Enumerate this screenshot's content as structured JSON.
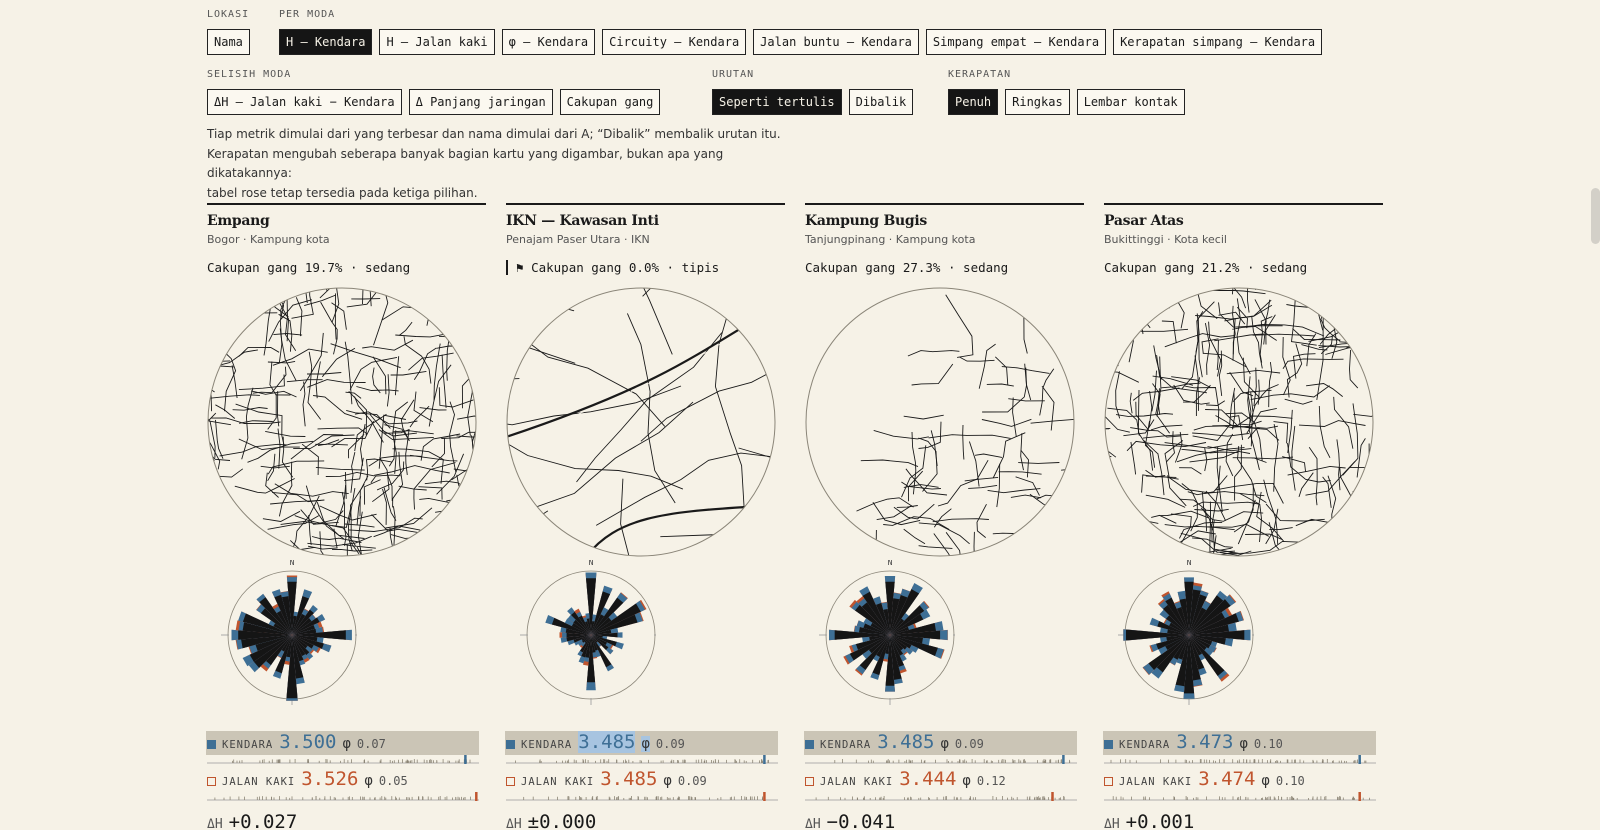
{
  "controls": {
    "lokasi": {
      "caption": "LOKASI",
      "options": [
        "Nama"
      ]
    },
    "per_moda": {
      "caption": "PER MODA",
      "options": [
        "H — Kendara",
        "H — Jalan kaki",
        "φ — Kendara",
        "Circuity — Kendara",
        "Jalan buntu — Kendara",
        "Simpang empat — Kendara",
        "Kerapatan simpang — Kendara"
      ],
      "active": "H — Kendara"
    },
    "selisih_moda": {
      "caption": "SELISIH MODA",
      "options": [
        "ΔH — Jalan kaki − Kendara",
        "Δ Panjang jaringan",
        "Cakupan gang"
      ]
    },
    "urutan": {
      "caption": "URUTAN",
      "options": [
        "Seperti tertulis",
        "Dibalik"
      ],
      "active": "Seperti tertulis"
    },
    "kerapatan": {
      "caption": "KERAPATAN",
      "options": [
        "Penuh",
        "Ringkas",
        "Lembar kontak"
      ],
      "active": "Penuh"
    }
  },
  "description": [
    "Tiap metrik dimulai dari yang terbesar dan nama dimulai dari A; “Dibalik” membalik urutan itu.",
    "Kerapatan mengubah seberapa banyak bagian kartu yang digambar, bukan apa yang dikatakannya:",
    "tabel rose tetap tersedia pada ketiga pilihan."
  ],
  "labels": {
    "north": "N",
    "kendara": "KENDARA",
    "jalan_kaki": "JALAN KAKI",
    "phi": "φ",
    "delta": "ΔH"
  },
  "colors": {
    "drive": "#3e6f95",
    "walk": "#c0552e",
    "ink": "#1a1a1a",
    "paper": "#f6f2e7",
    "highlight": "#a7c4e0"
  },
  "cards": [
    {
      "title": "Empang",
      "subtitle": "Bogor · Kampung kota",
      "coverage": "Cakupan gang 19.7% · sedang",
      "flag": false,
      "drive": {
        "h": "3.500",
        "phi": "0.07",
        "pos": 0.95
      },
      "walk": {
        "h": "3.526",
        "phi": "0.05",
        "pos": 0.99
      },
      "delta": "+0.027",
      "map_style": "dense"
    },
    {
      "title": "IKN — Kawasan Inti",
      "subtitle": "Penajam Paser Utara · IKN",
      "coverage": "Cakupan gang 0.0% · tipis",
      "flag": true,
      "flag_icon": "⚑",
      "drive": {
        "h": "3.485",
        "phi": "0.09",
        "pos": 0.95
      },
      "walk": {
        "h": "3.485",
        "phi": "0.09",
        "pos": 0.95
      },
      "delta": "±0.000",
      "map_style": "sparse"
    },
    {
      "title": "Kampung Bugis",
      "subtitle": "Tanjungpinang · Kampung kota",
      "coverage": "Cakupan gang 27.3% · sedang",
      "flag": false,
      "drive": {
        "h": "3.485",
        "phi": "0.09",
        "pos": 0.95
      },
      "walk": {
        "h": "3.444",
        "phi": "0.12",
        "pos": 0.91
      },
      "delta": "−0.041",
      "map_style": "coastal"
    },
    {
      "title": "Pasar Atas",
      "subtitle": "Bukittinggi · Kota kecil",
      "coverage": "Cakupan gang 21.2% · sedang",
      "flag": false,
      "drive": {
        "h": "3.473",
        "phi": "0.10",
        "pos": 0.94
      },
      "walk": {
        "h": "3.474",
        "phi": "0.10",
        "pos": 0.94
      },
      "delta": "+0.001",
      "map_style": "dense"
    }
  ]
}
